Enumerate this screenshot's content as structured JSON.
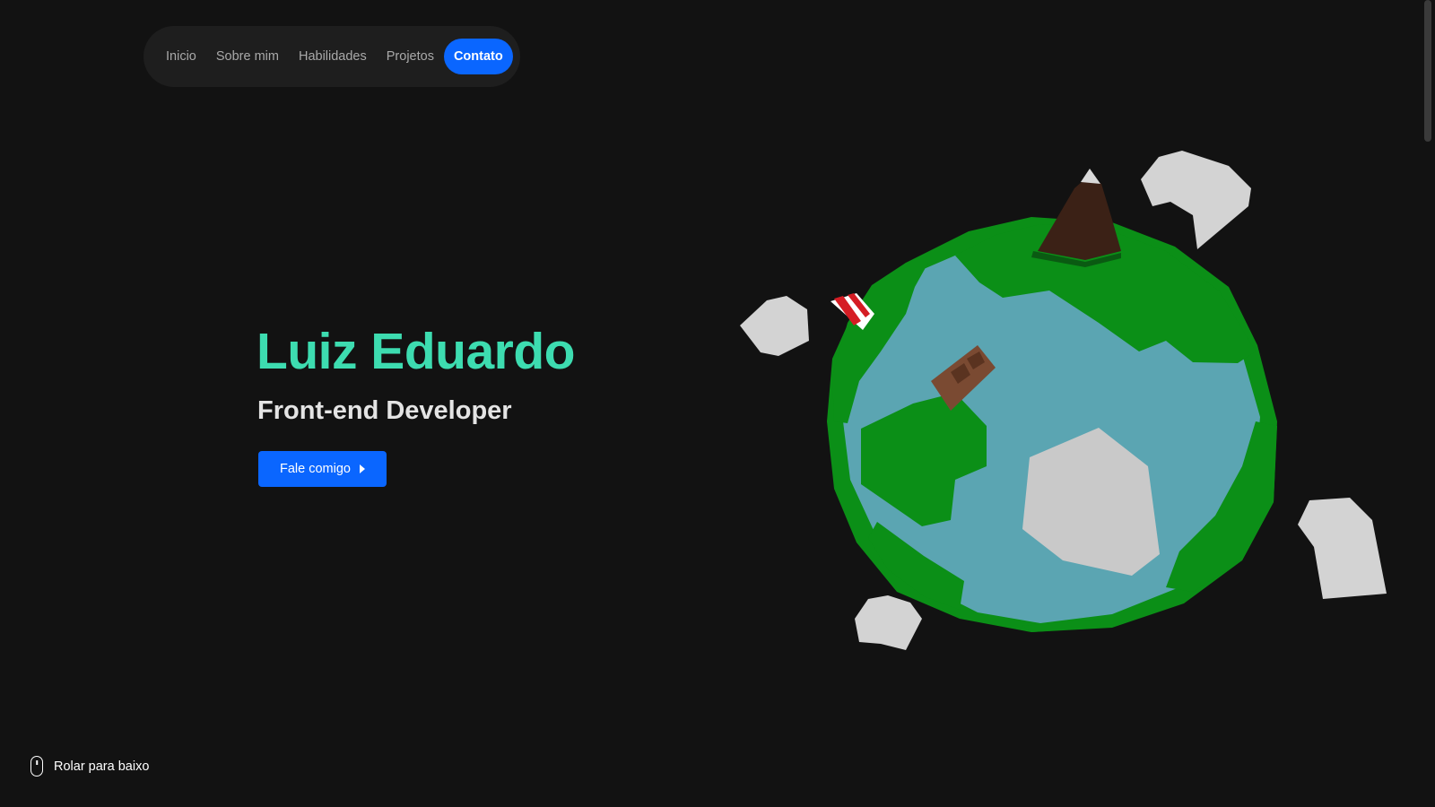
{
  "nav": {
    "items": [
      {
        "label": "Inicio"
      },
      {
        "label": "Sobre mim"
      },
      {
        "label": "Habilidades"
      },
      {
        "label": "Projetos"
      },
      {
        "label": "Contato",
        "active": true
      }
    ]
  },
  "hero": {
    "name": "Luiz Eduardo",
    "role": "Front-end Developer",
    "cta_label": "Fale comigo",
    "cta_icon": "caret-right-icon"
  },
  "scroll_hint": {
    "label": "Rolar para baixo",
    "icon": "mouse-icon"
  },
  "colors": {
    "background": "#121212",
    "accent": "#0a66ff",
    "name": "#3ddcb0",
    "ocean": "#5ba5b2",
    "land": "#0b8f17",
    "rock": "#d3d3d3",
    "mountain": "#3b2116"
  }
}
